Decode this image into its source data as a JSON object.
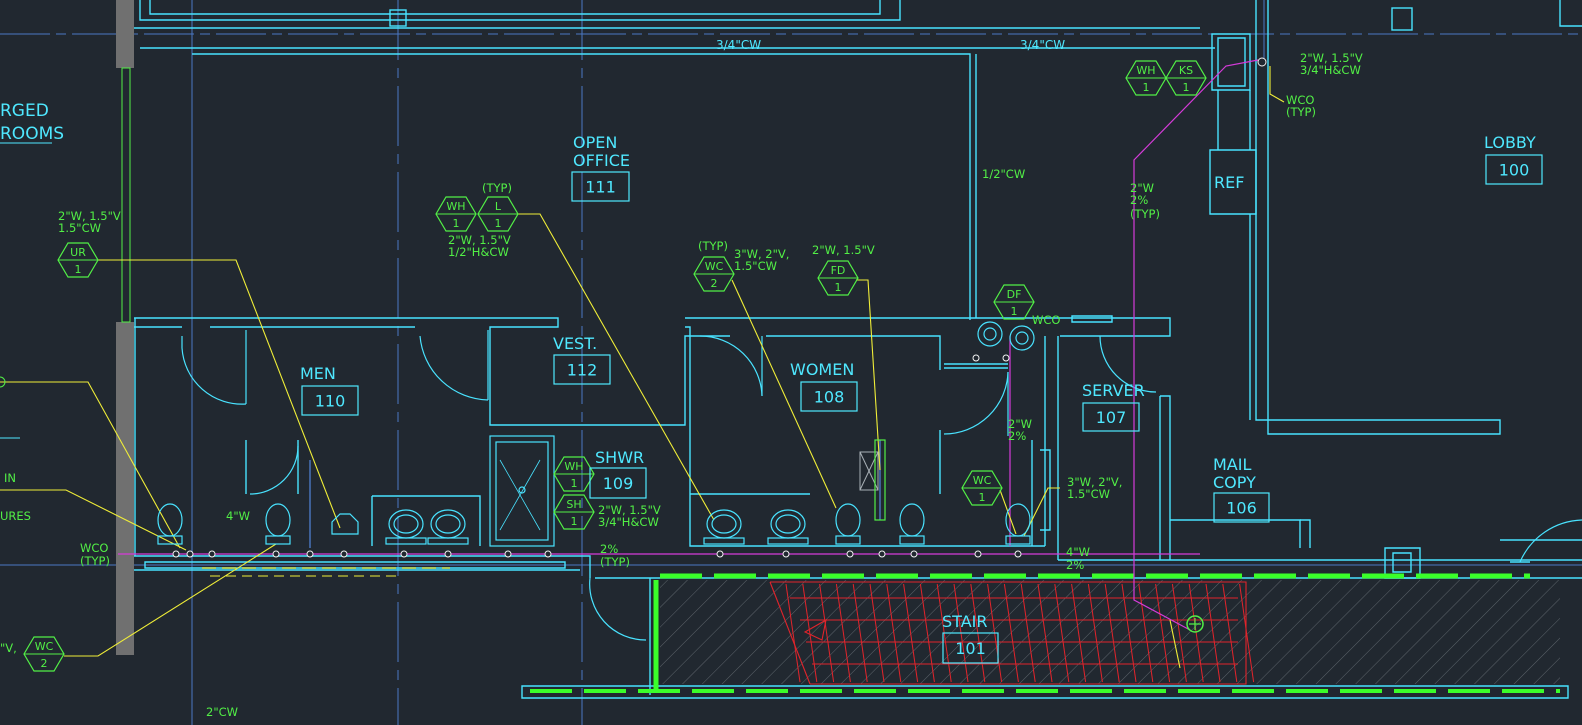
{
  "colors": {
    "background": "#212830",
    "wall": "#49e3ff",
    "room_text": "#4fe8ff",
    "note_green": "#52f046",
    "leader_yellow": "#f0ee38",
    "pipe_magenta": "#d53bd9",
    "stair_red": "#e1242b",
    "dash_green": "#3aff2a",
    "grid_blue": "#4b78c4",
    "column_gray": "#707070"
  },
  "rooms": [
    {
      "id": "open-office",
      "name_lines": [
        "OPEN",
        "OFFICE"
      ],
      "number": "111"
    },
    {
      "id": "men",
      "name_lines": [
        "MEN"
      ],
      "number": "110"
    },
    {
      "id": "vestibule",
      "name_lines": [
        "VEST."
      ],
      "number": "112"
    },
    {
      "id": "women",
      "name_lines": [
        "WOMEN"
      ],
      "number": "108"
    },
    {
      "id": "shower",
      "name_lines": [
        "SHWR"
      ],
      "number": "109"
    },
    {
      "id": "server",
      "name_lines": [
        "SERVER"
      ],
      "number": "107"
    },
    {
      "id": "mail-copy",
      "name_lines": [
        "MAIL",
        "COPY"
      ],
      "number": "106"
    },
    {
      "id": "lobby",
      "name_lines": [
        "LOBBY"
      ],
      "number": "100"
    },
    {
      "id": "stair",
      "name_lines": [
        "STAIR"
      ],
      "number": "101"
    }
  ],
  "labels": {
    "refrigerator": "REF",
    "left_heading_line1": "RGED",
    "left_heading_line2": "ROOMS",
    "left_fragment_in": "IN",
    "left_fragment_ures": "URES",
    "left_fragment_v": "\"V,"
  },
  "pipe_notes": [
    "3/4\"CW",
    "3/4\"CW",
    "1/2\"CW",
    "2\"CW",
    "2\"W, 1.5\"V",
    "1.5\"CW",
    "2\"W, 1.5\"V",
    "1/2\"H&CW",
    "(TYP)",
    "(TYP)",
    "3\"W, 2\"V,",
    "1.5\"CW",
    "2\"W, 1.5\"V",
    "2\"W, 1.5\"V",
    "3/4\"H&CW",
    "WCO",
    "(TYP)",
    "2\"W",
    "2%",
    "(TYP)",
    "WCO",
    "2\"W, 1.5\"V",
    "3/4\"H&CW",
    "2\"W",
    "2%",
    "3\"W, 2\"V,",
    "1.5\"CW",
    "4\"W",
    "2%",
    "2%",
    "(TYP)",
    "4\"W",
    "WCO",
    "(TYP)"
  ],
  "fixture_tags": [
    {
      "code": "UR",
      "count": "1"
    },
    {
      "code": "WH",
      "count": "1"
    },
    {
      "code": "L",
      "count": "1"
    },
    {
      "code": "WC",
      "count": "2"
    },
    {
      "code": "FD",
      "count": "1"
    },
    {
      "code": "DF",
      "count": "1"
    },
    {
      "code": "WH",
      "count": "1"
    },
    {
      "code": "KS",
      "count": "1"
    },
    {
      "code": "WH",
      "count": "1"
    },
    {
      "code": "SH",
      "count": "1"
    },
    {
      "code": "WC",
      "count": "1"
    },
    {
      "code": "WC",
      "count": "2"
    }
  ]
}
